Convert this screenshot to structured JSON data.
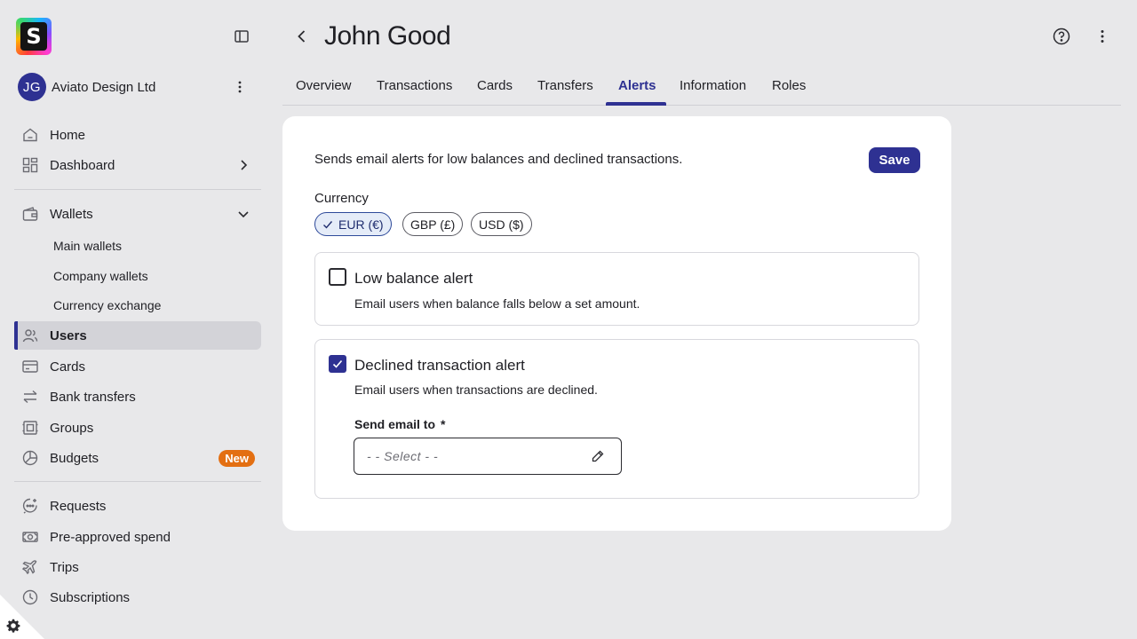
{
  "app": {
    "logo_letter": "S",
    "colors": {
      "accent": "#2e3192",
      "badge": "#e36f12",
      "active_bg": "#d3d3d8",
      "page_bg": "#e8e8ea"
    }
  },
  "sidebar": {
    "org": {
      "initials": "JG",
      "name": "Aviato Design Ltd"
    },
    "items": [
      {
        "label": "Home",
        "icon": "home-icon"
      },
      {
        "label": "Dashboard",
        "icon": "dashboard-icon"
      },
      {
        "label": "Wallets",
        "icon": "wallet-icon"
      },
      {
        "label": "Users",
        "icon": "users-icon",
        "active": true
      },
      {
        "label": "Cards",
        "icon": "card-icon"
      },
      {
        "label": "Bank transfers",
        "icon": "transfer-icon"
      },
      {
        "label": "Groups",
        "icon": "groups-icon"
      },
      {
        "label": "Budgets",
        "icon": "budget-icon",
        "badge": "New"
      },
      {
        "label": "Requests",
        "icon": "requests-icon"
      },
      {
        "label": "Pre-approved spend",
        "icon": "money-icon"
      },
      {
        "label": "Trips",
        "icon": "plane-icon"
      },
      {
        "label": "Subscriptions",
        "icon": "clock-icon"
      }
    ],
    "wallet_sub": [
      "Main wallets",
      "Company wallets",
      "Currency exchange"
    ]
  },
  "header": {
    "title": "John Good",
    "tabs": [
      "Overview",
      "Transactions",
      "Cards",
      "Transfers",
      "Alerts",
      "Information",
      "Roles"
    ],
    "active_tab": "Alerts"
  },
  "alerts": {
    "description": "Sends email alerts for low balances and declined transactions.",
    "save_label": "Save",
    "currency_label": "Currency",
    "currencies": [
      {
        "label": "EUR (€)",
        "selected": true
      },
      {
        "label": "GBP (£)",
        "selected": false
      },
      {
        "label": "USD ($)",
        "selected": false
      }
    ],
    "low_balance": {
      "title": "Low balance alert",
      "subtitle": "Email users when balance falls below a set amount.",
      "checked": false
    },
    "declined": {
      "title": "Declined transaction alert",
      "subtitle": "Email users when transactions are declined.",
      "checked": true,
      "field_label": "Send email to",
      "required_mark": "*",
      "placeholder": "- - Select - -"
    }
  }
}
